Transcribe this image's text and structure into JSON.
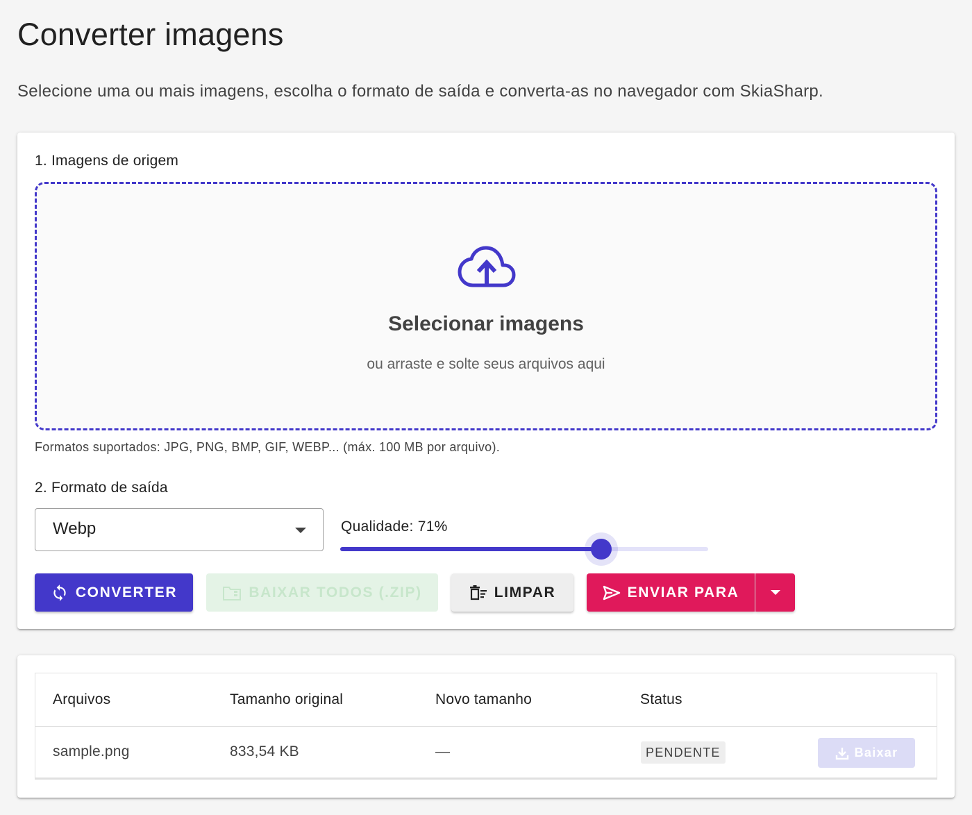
{
  "page": {
    "title": "Converter imagens",
    "subtitle": "Selecione uma ou mais imagens, escolha o formato de saída e converta-as no navegador com SkiaSharp."
  },
  "source": {
    "section_label": "1. Imagens de origem",
    "dropzone_icon": "cloud-upload-icon",
    "dropzone_title": "Selecionar imagens",
    "dropzone_subtitle": "ou arraste e solte seus arquivos aqui",
    "help_text": "Formatos suportados: JPG, PNG, BMP, GIF, WEBP... (máx. 100 MB por arquivo)."
  },
  "output": {
    "section_label": "2. Formato de saída",
    "format_selected": "Webp",
    "quality_label": "Qualidade: 71%",
    "quality_value": 71,
    "quality_max": 100
  },
  "actions": {
    "convert": {
      "label": "Converter",
      "icon": "sync-icon"
    },
    "download_all": {
      "label": "Baixar todos (.zip)",
      "icon": "folder-zip-icon",
      "disabled": true
    },
    "clear": {
      "label": "Limpar",
      "icon": "delete-sweep-icon"
    },
    "send_to": {
      "label": "Enviar para",
      "icon": "send-icon"
    },
    "send_menu_icon": "caret-down-icon"
  },
  "colors": {
    "primary": "#4338ca",
    "accent": "#e0195b",
    "background": "#f5f5f5"
  },
  "files_table": {
    "headers": [
      "Arquivos",
      "Tamanho original",
      "Novo tamanho",
      "Status"
    ],
    "rows": [
      {
        "name": "sample.png",
        "original_size": "833,54 KB",
        "new_size": "—",
        "status": "PENDENTE",
        "action": "Baixar",
        "action_icon": "download-icon"
      }
    ]
  }
}
